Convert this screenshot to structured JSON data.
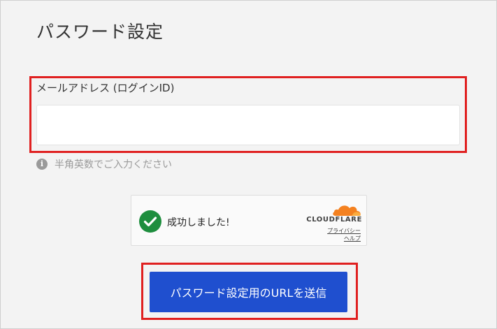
{
  "page": {
    "title": "パスワード設定"
  },
  "form": {
    "email_label": "メールアドレス (ログインID)",
    "email_value": "",
    "email_placeholder": "",
    "hint_text": "半角英数でご入力ください",
    "submit_label": "パスワード設定用のURLを送信"
  },
  "captcha": {
    "status_text": "成功しました!",
    "brand": "CLOUDFLARE",
    "privacy_link": "プライバシー",
    "help_link": "ヘルプ"
  },
  "colors": {
    "highlight": "#e02020",
    "button": "#1f4fcf",
    "success": "#1e8e3e",
    "cloudflare_orange": "#f48120",
    "cloudflare_light": "#faad3f"
  },
  "icons": {
    "hint": "info-icon",
    "captcha_status": "check-circle-icon",
    "captcha_logo": "cloudflare-cloud-icon"
  }
}
